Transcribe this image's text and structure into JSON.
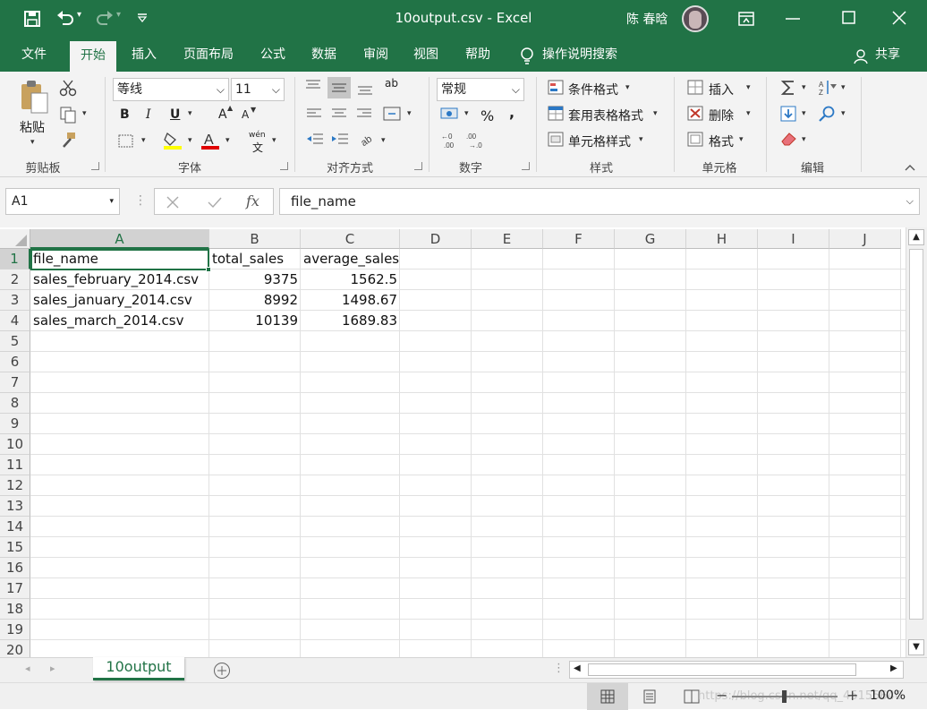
{
  "window": {
    "title": "10output.csv  -  Excel",
    "user": "陈 春晗",
    "minimize_icon": "minimize-icon",
    "maximize_icon": "maximize-icon",
    "close_icon": "close-icon"
  },
  "tabs": [
    "文件",
    "开始",
    "插入",
    "页面布局",
    "公式",
    "数据",
    "审阅",
    "视图",
    "帮助"
  ],
  "active_tab": "开始",
  "tell_me": "操作说明搜索",
  "share": "共享",
  "ribbon": {
    "clipboard": {
      "paste": "粘贴",
      "label": "剪贴板"
    },
    "font": {
      "name": "等线",
      "size": "11",
      "label": "字体",
      "bold": "B",
      "italic": "I",
      "underline": "U",
      "grow": "A",
      "shrink": "A",
      "phonetic": "wén"
    },
    "alignment": {
      "label": "对齐方式",
      "wrap": "ab"
    },
    "number": {
      "format": "常规",
      "label": "数字",
      "percent": "%",
      "comma": ","
    },
    "styles": {
      "conditional": "条件格式",
      "table": "套用表格格式",
      "cell": "单元格样式",
      "label": "样式"
    },
    "cells": {
      "insert": "插入",
      "delete": "删除",
      "format": "格式",
      "label": "单元格"
    },
    "editing": {
      "label": "编辑"
    }
  },
  "formula_bar": {
    "name_box": "A1",
    "fx": "fx",
    "content": "file_name"
  },
  "columns": [
    "A",
    "B",
    "C",
    "D",
    "E",
    "F",
    "G",
    "H",
    "I",
    "J"
  ],
  "rows": [
    "1",
    "2",
    "3",
    "4",
    "5",
    "6",
    "7",
    "8",
    "9",
    "10",
    "11",
    "12",
    "13",
    "14",
    "15",
    "16",
    "17",
    "18",
    "19",
    "20"
  ],
  "table": [
    [
      "file_name",
      "total_sales",
      "average_sales"
    ],
    [
      "sales_february_2014.csv",
      "9375",
      "1562.5"
    ],
    [
      "sales_january_2014.csv",
      "8992",
      "1498.67"
    ],
    [
      "sales_march_2014.csv",
      "10139",
      "1689.83"
    ]
  ],
  "sheet_tab": "10output",
  "status": {
    "zoom": "100%",
    "watermark": "https://blog.csdn.net/qq_45155640"
  },
  "colors": {
    "excel_green": "#217346",
    "ribbon_bg": "#f3f3f3",
    "selection": "#217346"
  }
}
